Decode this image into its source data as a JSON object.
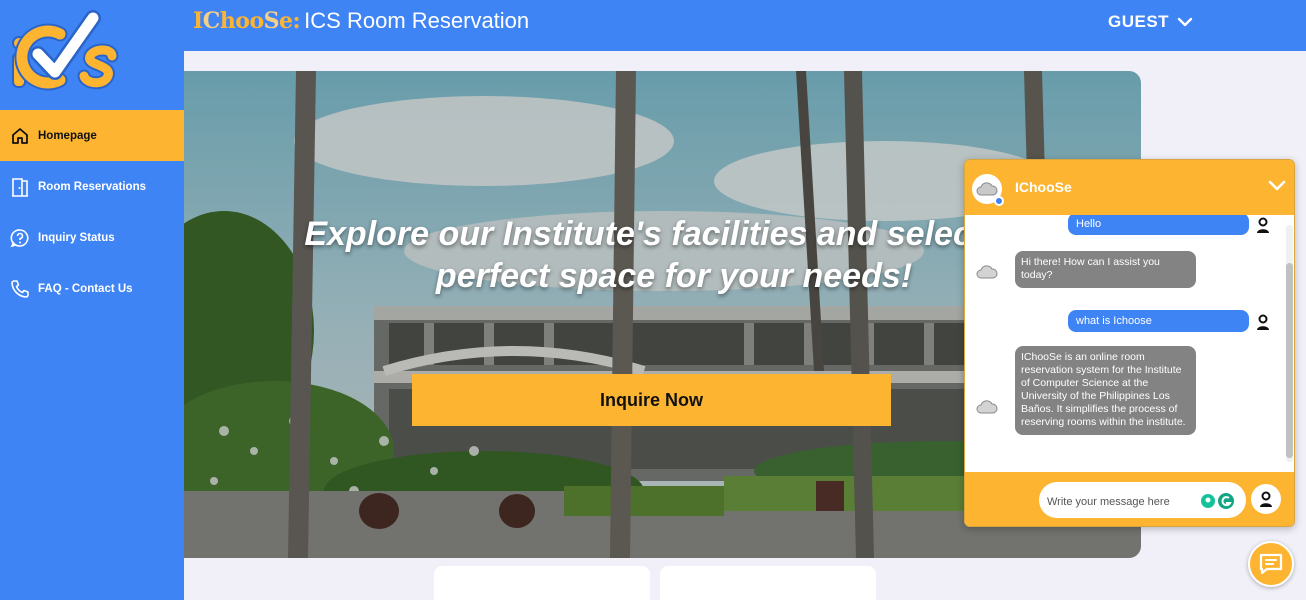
{
  "sidebar": {
    "logo_text": "iCS",
    "items": [
      {
        "label": "Homepage",
        "icon": "home-icon",
        "active": true
      },
      {
        "label": "Room Reservations",
        "icon": "door-icon",
        "active": false
      },
      {
        "label": "Inquiry Status",
        "icon": "question-icon",
        "active": false
      },
      {
        "label": "FAQ - Contact Us",
        "icon": "phone-icon",
        "active": false
      }
    ]
  },
  "header": {
    "brand_i": "I",
    "brand_c": "C",
    "brand_hoo": "hoo",
    "brand_s": "S",
    "brand_e": "e:",
    "title": "ICS Room Reservation",
    "user_label": "GUEST",
    "user_menu_icon": "chevron-down-icon"
  },
  "hero": {
    "headline": "Explore our Institute's facilities and select the perfect space for your needs!",
    "button_label": "Inquire Now"
  },
  "chat": {
    "bot_name": "IChooSe",
    "collapse_icon": "chevron-down-icon",
    "messages": [
      {
        "from": "user",
        "text": "Hello"
      },
      {
        "from": "bot",
        "text": "Hi there! How can I assist you today?"
      },
      {
        "from": "user",
        "text": "what is Ichoose"
      },
      {
        "from": "bot",
        "text": "IChooSe is an online room reservation system for the Institute of Computer Science at the University of the Philippines Los Baños. It simplifies the process of reserving rooms within the institute."
      }
    ],
    "input_placeholder": "Write your message here",
    "send_icon": "user-avatar-icon",
    "launcher_icon": "chat-bubble-icon"
  },
  "colors": {
    "primary_blue": "#3f84f4",
    "accent_orange": "#fdb531",
    "bot_bubble": "#838383",
    "page_bg": "#f1f0f8"
  }
}
